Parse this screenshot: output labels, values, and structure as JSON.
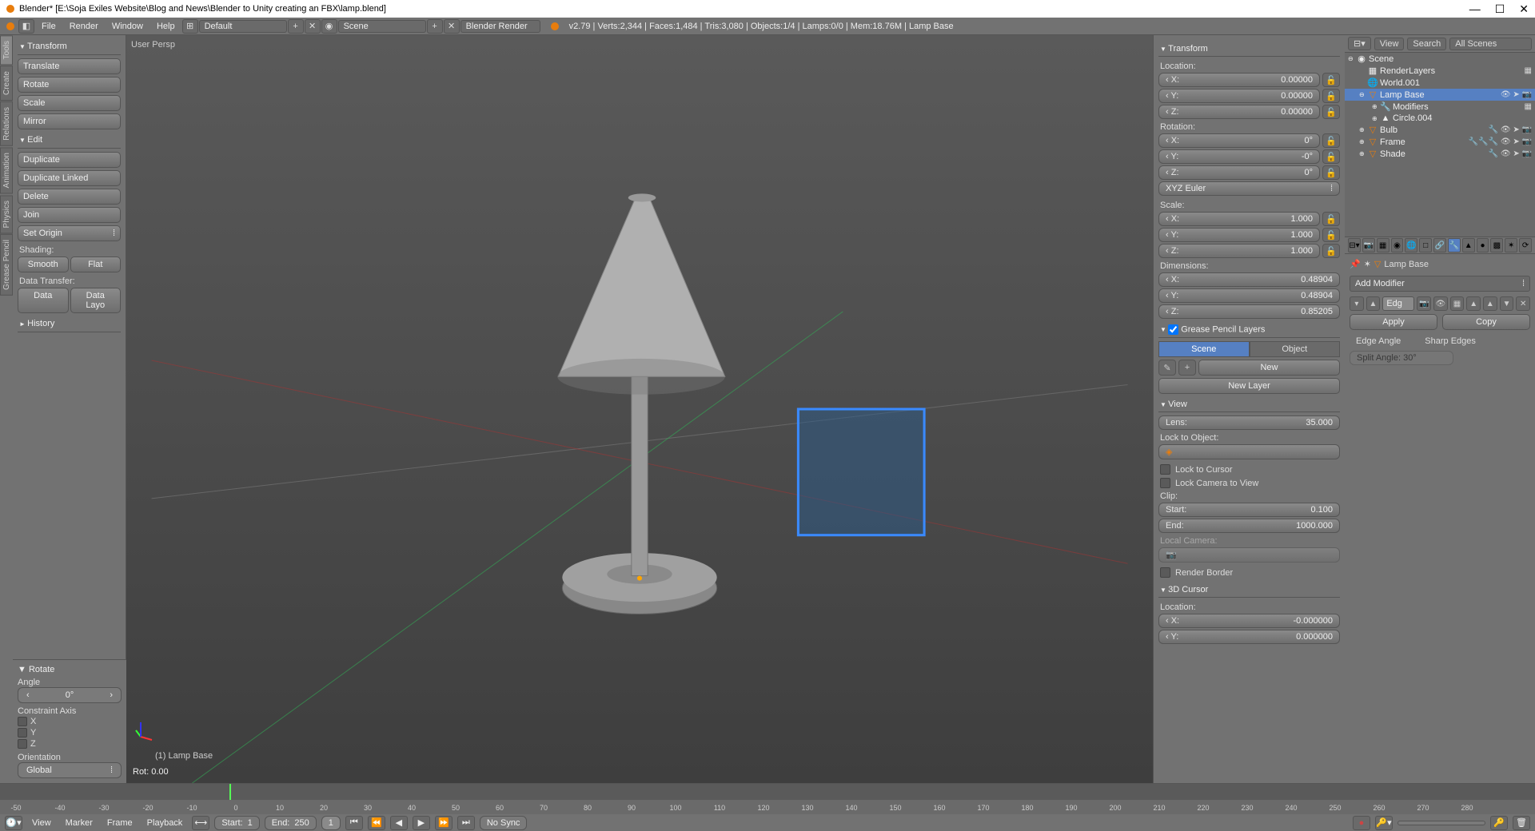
{
  "window": {
    "title": "Blender* [E:\\Soja Exiles Website\\Blog and News\\Blender to Unity creating an FBX\\lamp.blend]"
  },
  "menu": {
    "file": "File",
    "render": "Render",
    "window": "Window",
    "help": "Help"
  },
  "header": {
    "layout": "Default",
    "scene": "Scene",
    "engine": "Blender Render",
    "version": "v2.79",
    "stats": "Verts:2,344 | Faces:1,484 | Tris:3,080 | Objects:1/4 | Lamps:0/0 | Mem:18.76M | Lamp Base"
  },
  "lefttabs": [
    "Tools",
    "Create",
    "Relations",
    "Animation",
    "Physics",
    "Grease Pencil"
  ],
  "tools": {
    "transform_hdr": "Transform",
    "translate": "Translate",
    "rotate": "Rotate",
    "scale": "Scale",
    "mirror": "Mirror",
    "edit_hdr": "Edit",
    "duplicate": "Duplicate",
    "duplicate_linked": "Duplicate Linked",
    "delete": "Delete",
    "join": "Join",
    "set_origin": "Set Origin",
    "shading_lbl": "Shading:",
    "smooth": "Smooth",
    "flat": "Flat",
    "data_transfer_lbl": "Data Transfer:",
    "data": "Data",
    "data_layout": "Data Layo",
    "history_hdr": "History"
  },
  "op": {
    "hdr": "Rotate",
    "angle_lbl": "Angle",
    "angle_val": "0°",
    "constraint_lbl": "Constraint Axis",
    "x": "X",
    "y": "Y",
    "z": "Z",
    "orientation_lbl": "Orientation",
    "orientation_val": "Global"
  },
  "viewport": {
    "persp": "User Persp",
    "object": "(1) Lamp Base",
    "status": "Rot: 0.00"
  },
  "npanel": {
    "transform_hdr": "Transform",
    "location_lbl": "Location:",
    "loc_x": "0.00000",
    "loc_y": "0.00000",
    "loc_z": "0.00000",
    "rotation_lbl": "Rotation:",
    "rot_x": "0°",
    "rot_y": "-0°",
    "rot_z": "0°",
    "rotmode": "XYZ Euler",
    "scale_lbl": "Scale:",
    "sc_x": "1.000",
    "sc_y": "1.000",
    "sc_z": "1.000",
    "dim_lbl": "Dimensions:",
    "dim_x": "0.48904",
    "dim_y": "0.48904",
    "dim_z": "0.85205",
    "gp_hdr": "Grease Pencil Layers",
    "gp_scene": "Scene",
    "gp_object": "Object",
    "gp_new": "New",
    "gp_newlayer": "New Layer",
    "view_hdr": "View",
    "lens_lbl": "Lens:",
    "lens_val": "35.000",
    "lockobj_lbl": "Lock to Object:",
    "lockcursor": "Lock to Cursor",
    "lockcamera": "Lock Camera to View",
    "clip_lbl": "Clip:",
    "clip_start": "Start:",
    "clip_start_v": "0.100",
    "clip_end": "End:",
    "clip_end_v": "1000.000",
    "localcam_lbl": "Local Camera:",
    "renderborder": "Render Border",
    "cursor_hdr": "3D Cursor",
    "cursor_loc": "Location:",
    "cur_x": "-0.000000",
    "cur_y": "0.000000"
  },
  "outliner_hdr": {
    "view": "View",
    "search": "Search",
    "filter": "All Scenes"
  },
  "outliner": {
    "scene": "Scene",
    "renderlayers": "RenderLayers",
    "world": "World.001",
    "lampbase": "Lamp Base",
    "modifiers": "Modifiers",
    "circle": "Circle.004",
    "bulb": "Bulb",
    "frame": "Frame",
    "shade": "Shade"
  },
  "props": {
    "objname": "Lamp Base",
    "addmod": "Add Modifier",
    "modname": "Edg",
    "apply": "Apply",
    "copy": "Copy",
    "edge_angle": "Edge Angle",
    "sharp_edges": "Sharp Edges",
    "split_angle": "Split Angle: 30°"
  },
  "timeline": {
    "view": "View",
    "marker": "Marker",
    "frame": "Frame",
    "playback": "Playback",
    "start": "Start:",
    "start_v": "1",
    "end": "End:",
    "end_v": "250",
    "current": "1",
    "nosync": "No Sync",
    "ticks": [
      "-50",
      "-40",
      "-30",
      "-20",
      "-10",
      "0",
      "10",
      "20",
      "30",
      "40",
      "50",
      "60",
      "70",
      "80",
      "90",
      "100",
      "110",
      "120",
      "130",
      "140",
      "150",
      "160",
      "170",
      "180",
      "190",
      "200",
      "210",
      "220",
      "230",
      "240",
      "250",
      "260",
      "270",
      "280"
    ]
  }
}
